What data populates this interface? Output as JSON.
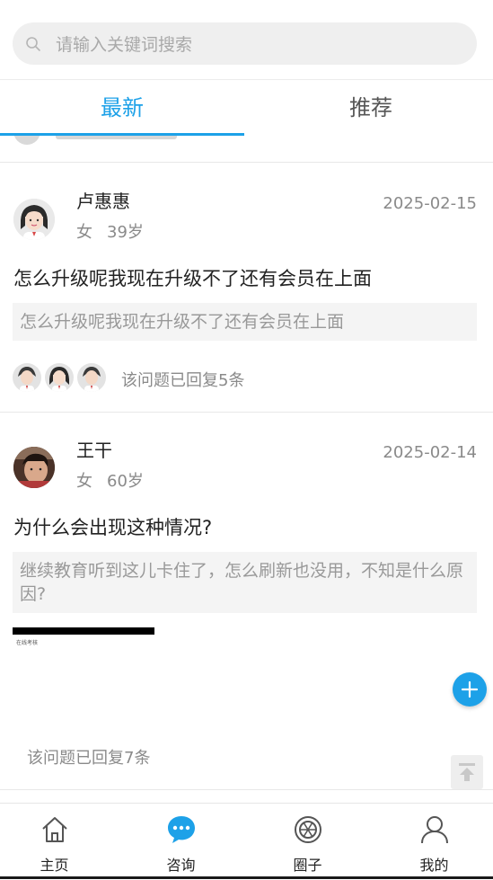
{
  "search": {
    "placeholder": "请输入关键词搜索"
  },
  "tabs": [
    {
      "label": "最新"
    },
    {
      "label": "推荐"
    }
  ],
  "posts": [
    {
      "name": "卢惠惠",
      "gender": "女",
      "age": "39岁",
      "date": "2025-02-15",
      "title": "怎么升级呢我现在升级不了还有会员在上面",
      "description": "怎么升级呢我现在升级不了还有会员在上面",
      "reply_text": "该问题已回复5条"
    },
    {
      "name": "王干",
      "gender": "女",
      "age": "60岁",
      "date": "2025-02-14",
      "title": "为什么会出现这种情况?",
      "description": "继续教育听到这儿卡住了，怎么刷新也没用，不知是什么原因?",
      "image_caption": "在线考核",
      "reply_text": "该问题已回复7条"
    }
  ],
  "nav": [
    {
      "label": "主页",
      "icon": "home-icon"
    },
    {
      "label": "咨询",
      "icon": "chat-icon",
      "active": true
    },
    {
      "label": "圈子",
      "icon": "aperture-icon"
    },
    {
      "label": "我的",
      "icon": "user-icon"
    }
  ],
  "colors": {
    "accent": "#1da1e8",
    "muted": "#8a8a8a"
  }
}
